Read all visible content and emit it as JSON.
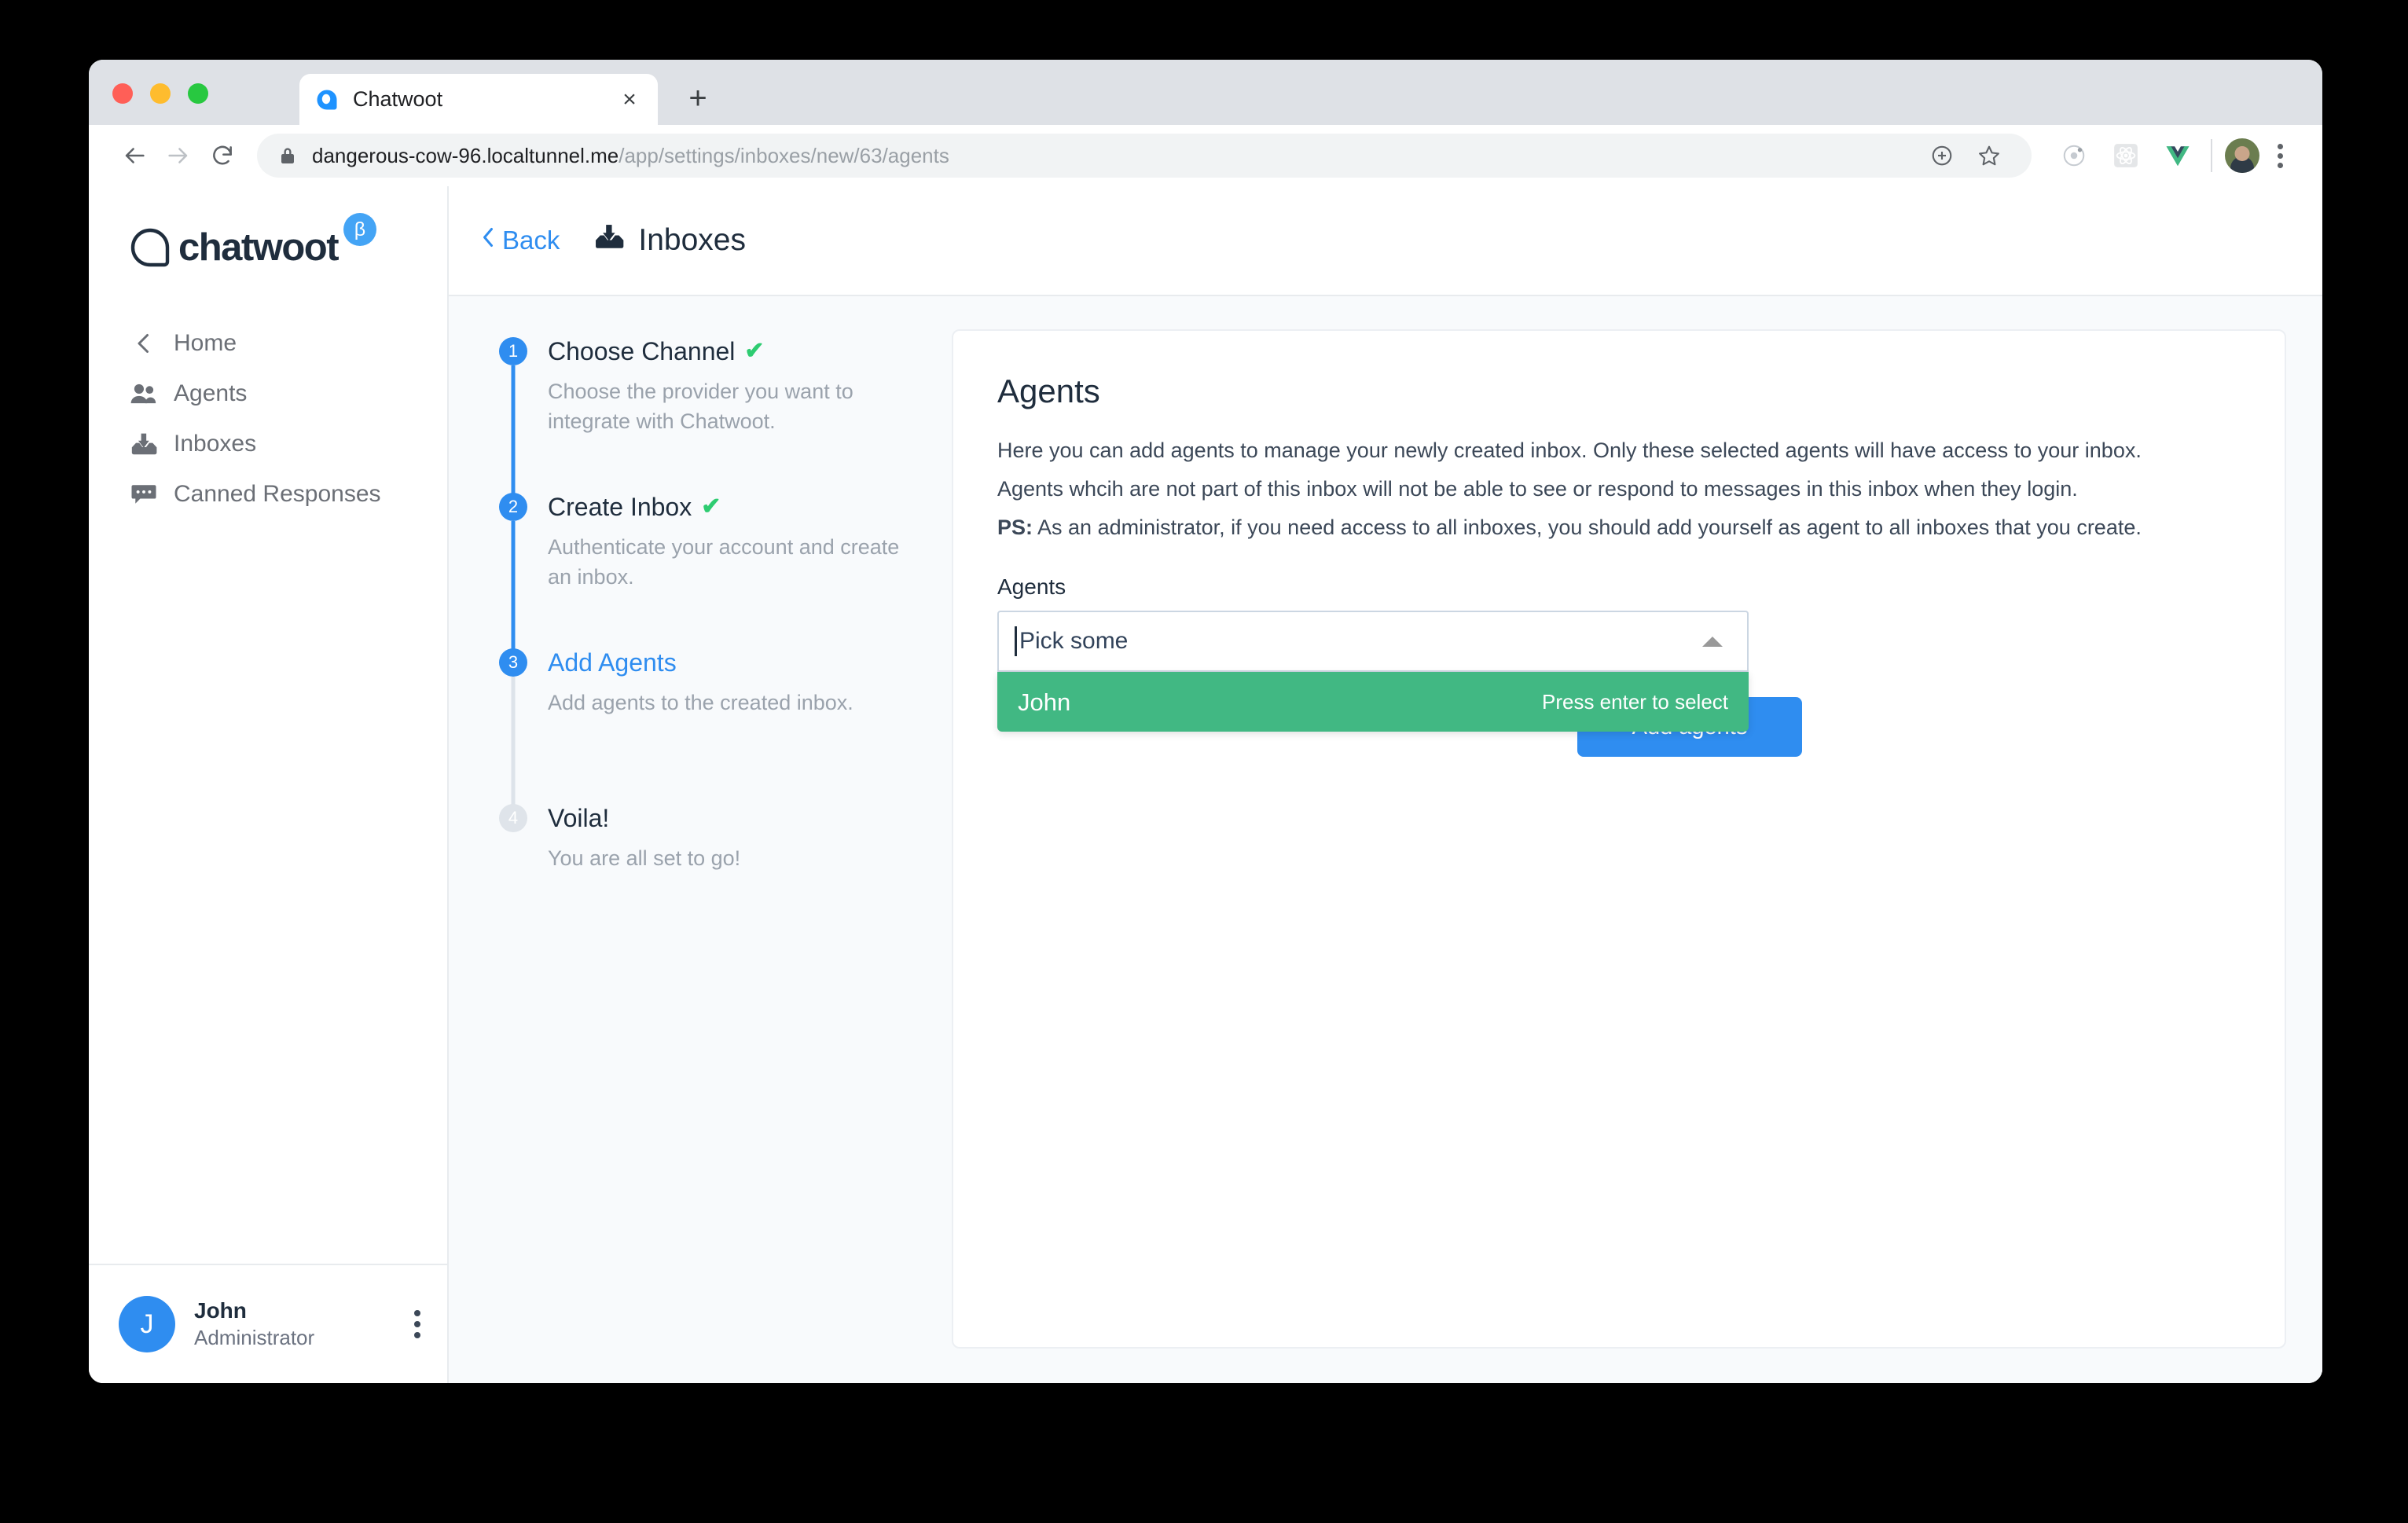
{
  "browser": {
    "tab": {
      "title": "Chatwoot",
      "favicon": "chatwoot-favicon",
      "close_label": "×"
    },
    "new_tab_label": "+",
    "nav": {
      "back": "←",
      "forward": "→",
      "reload": "↻"
    },
    "omnibox": {
      "domain": "dangerous-cow-96.localtunnel.me",
      "path": "/app/settings/inboxes/new/63/agents"
    }
  },
  "sidebar": {
    "logo_text": "chatwoot",
    "beta_badge": "β",
    "items": [
      {
        "label": "Home",
        "icon": "chevron-left-icon"
      },
      {
        "label": "Agents",
        "icon": "people-icon"
      },
      {
        "label": "Inboxes",
        "icon": "inbox-icon"
      },
      {
        "label": "Canned Responses",
        "icon": "chat-bubble-icon"
      }
    ],
    "user": {
      "initial": "J",
      "name": "John",
      "role": "Administrator"
    }
  },
  "header": {
    "back_label": "Back",
    "title": "Inboxes"
  },
  "wizard": {
    "steps": [
      {
        "number": "1",
        "title": "Choose Channel",
        "description": "Choose the provider you want to integrate with Chatwoot.",
        "completed": true,
        "active": false
      },
      {
        "number": "2",
        "title": "Create Inbox",
        "description": "Authenticate your account and create an inbox.",
        "completed": true,
        "active": false
      },
      {
        "number": "3",
        "title": "Add Agents",
        "description": "Add agents to the created inbox.",
        "completed": false,
        "active": true
      },
      {
        "number": "4",
        "title": "Voila!",
        "description": "You are all set to go!",
        "completed": false,
        "active": false
      }
    ]
  },
  "card": {
    "title": "Agents",
    "desc_line1": "Here you can add agents to manage your newly created inbox. Only these selected agents will have access to your inbox.",
    "desc_line2": "Agents whcih are not part of this inbox will not be able to see or respond to messages in this inbox when they login.",
    "desc_ps_label": "PS:",
    "desc_line3": " As an administrator, if you need access to all inboxes, you should add yourself as agent to all inboxes that you create.",
    "field_label": "Agents",
    "select": {
      "placeholder": "Pick some",
      "options": [
        {
          "label": "John",
          "hint": "Press enter to select",
          "highlighted": true
        }
      ]
    },
    "submit_label": "Add agents"
  },
  "colors": {
    "accent_blue": "#2f8df0",
    "option_green": "#41b883",
    "check_green": "#2ecc71",
    "text_dark": "#1f2d3d",
    "text_muted": "#9aa2ac",
    "panel_bg": "#f8fafc"
  }
}
